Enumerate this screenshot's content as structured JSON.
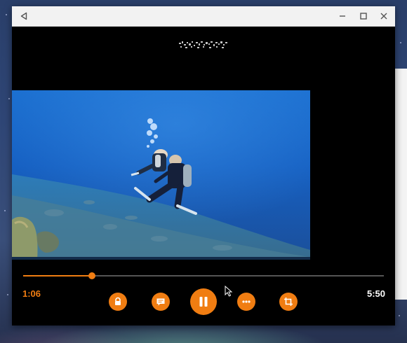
{
  "window": {
    "title_bar_buttons": [
      "back-icon",
      "minimize-icon",
      "maximize-icon",
      "close-icon"
    ]
  },
  "media": {
    "title": "",
    "title_is_obscured": true
  },
  "playback": {
    "current_time": "1:06",
    "total_time": "5:50",
    "progress_percent": 19,
    "state": "playing"
  },
  "controls": {
    "buttons": [
      {
        "name": "lock",
        "icon": "lock-icon"
      },
      {
        "name": "subtitles",
        "icon": "subtitles-icon"
      },
      {
        "name": "pause",
        "icon": "pause-icon"
      },
      {
        "name": "more",
        "icon": "more-dots-icon"
      },
      {
        "name": "aspect-ratio",
        "icon": "crop-icon"
      }
    ]
  },
  "colors": {
    "accent": "#f07d12",
    "player_background": "#000000",
    "titlebar": "#f2f2f2"
  }
}
